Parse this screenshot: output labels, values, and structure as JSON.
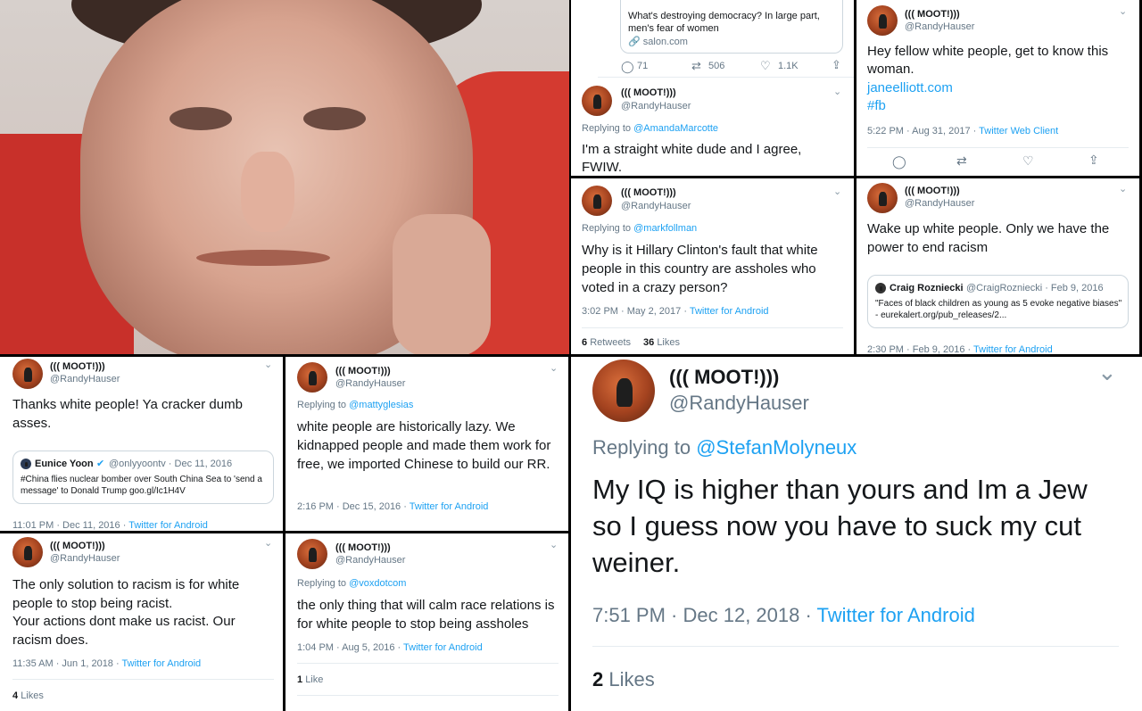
{
  "profile": {
    "name": "((( MOOT!)))",
    "handle": "@RandyHauser"
  },
  "icons": {
    "chevron": "chevron-down-icon",
    "reply": "reply-icon",
    "retweet": "retweet-icon",
    "like": "heart-icon",
    "share": "share-icon",
    "verified": "verified-badge-icon",
    "link": "link-icon"
  },
  "tweet_quote_card": {
    "title": "What's destroying democracy? In large part, men's fear of women",
    "domain": "salon.com",
    "reply_count": "71",
    "retweet_count": "506",
    "like_count": "1.1K"
  },
  "tweet_straight_white": {
    "replying_label": "Replying to",
    "replying_to": "@AmandaMarcotte",
    "text": "I'm a straight white dude and I agree, FWIW."
  },
  "tweet_fellow": {
    "text": "Hey fellow white people, get to know this woman.",
    "link": "janeelliott.com",
    "hashtag": "#fb",
    "time": "5:22 PM · Aug 31, 2017 · ",
    "source": "Twitter Web Client"
  },
  "tweet_hillary": {
    "replying_label": "Replying to",
    "replying_to": "@markfollman",
    "text": "Why is it Hillary Clinton's fault that white people in this country are assholes who voted in a crazy person?",
    "time": "3:02 PM · May 2, 2017 · ",
    "source": "Twitter for Android",
    "retweets_num": "6",
    "retweets_label": "Retweets",
    "likes_num": "36",
    "likes_label": "Likes"
  },
  "tweet_wakeup": {
    "text": "Wake up white people. Only we have the power to end racism",
    "quote_name": "Craig Rozniecki",
    "quote_handle": "@CraigRozniecki · Feb 9, 2016",
    "quote_text": "\"Faces of black children as young as 5 evoke negative biases\" - eurekalert.org/pub_releases/2...",
    "time": "2:30 PM · Feb 9, 2016 · ",
    "source": "Twitter for Android"
  },
  "tweet_thanks": {
    "text": "Thanks white people! Ya cracker dumb asses.",
    "quote_name": "Eunice Yoon",
    "quote_handle": "@onlyyoontv · Dec 11, 2016",
    "quote_text": "#China flies nuclear bomber over South China Sea to 'send a message' to Donald Trump goo.gl/Ic1H4V",
    "time": "11:01 PM · Dec 11, 2016 · ",
    "source": "Twitter for Android"
  },
  "tweet_lazy": {
    "replying_label": "Replying to",
    "replying_to": "@mattyglesias",
    "text": "white people are historically lazy. We kidnapped people and made them work for free, we imported Chinese to build our RR.",
    "time": "2:16 PM · Dec 15, 2016 · ",
    "source": "Twitter for Android"
  },
  "tweet_solution": {
    "text_line1": "The only solution to racism is for white people to stop being racist.",
    "text_line2": "Your actions dont make us racist. Our racism does.",
    "time": "11:35 AM · Jun 1, 2018 · ",
    "source": "Twitter for Android",
    "likes_num": "4",
    "likes_label": "Likes"
  },
  "tweet_calm": {
    "replying_label": "Replying to",
    "replying_to": "@voxdotcom",
    "text": "the only thing that will calm race relations is for white people to stop being assholes",
    "time": "1:04 PM · Aug 5, 2016 · ",
    "source": "Twitter for Android",
    "likes_num": "1",
    "likes_label": "Like"
  },
  "tweet_iq": {
    "replying_label": "Replying to",
    "replying_to": "@StefanMolyneux",
    "text": "My IQ is higher than yours and Im a Jew so I guess now you have to suck my cut weiner.",
    "time": "7:51 PM · Dec 12, 2018 · ",
    "source": "Twitter for Android",
    "likes_num": "2",
    "likes_label": "Likes"
  }
}
